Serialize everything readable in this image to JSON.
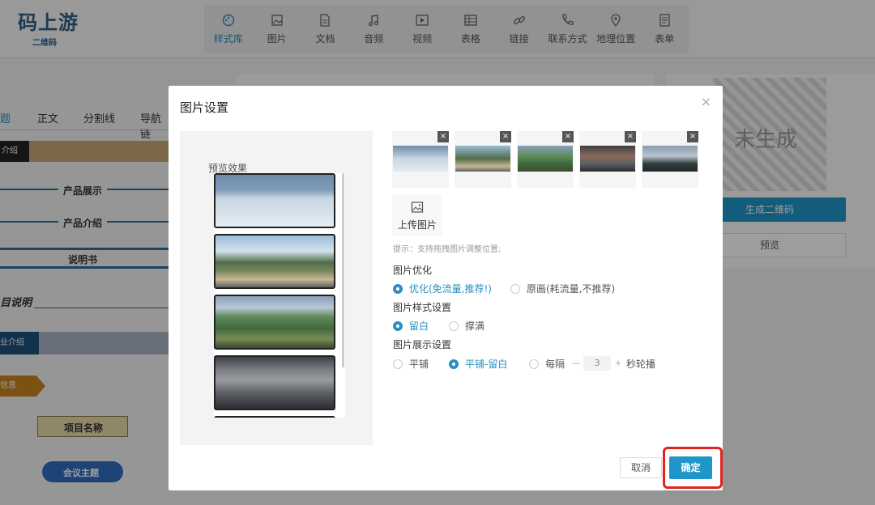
{
  "app": {
    "logo_text": "码上游",
    "logo_sub": "二维码"
  },
  "toolbar": {
    "items": [
      {
        "label": "样式库",
        "icon": "palette-icon"
      },
      {
        "label": "图片",
        "icon": "image-icon"
      },
      {
        "label": "文档",
        "icon": "document-icon"
      },
      {
        "label": "音频",
        "icon": "music-icon"
      },
      {
        "label": "视频",
        "icon": "video-icon"
      },
      {
        "label": "表格",
        "icon": "table-icon"
      },
      {
        "label": "链接",
        "icon": "link-icon"
      },
      {
        "label": "联系方式",
        "icon": "phone-icon"
      },
      {
        "label": "地理位置",
        "icon": "location-icon"
      },
      {
        "label": "表单",
        "icon": "form-icon"
      }
    ],
    "active_color": "#2a8fc0"
  },
  "left_panel": {
    "tabs": [
      "题",
      "正文",
      "分割线",
      "导航链"
    ],
    "items": [
      "介绍",
      "产品展示",
      "产品介绍",
      "说明书",
      "目说明",
      "业介绍",
      "信息",
      "项目名称",
      "会议主题"
    ]
  },
  "right_panel": {
    "qr_status": "未生成",
    "generate_btn": "生成二维码",
    "preview_btn": "预览"
  },
  "modal": {
    "title": "图片设置",
    "close": "×",
    "preview_label": "预览效果",
    "upload_label": "上传图片",
    "hint": "提示：支持拖拽图片调整位置;",
    "optimize": {
      "label": "图片优化",
      "options": [
        {
          "label": "优化(免流量,推荐!)",
          "selected": true
        },
        {
          "label": "原画(耗流量,不推荐)",
          "selected": false
        }
      ]
    },
    "style": {
      "label": "图片样式设置",
      "options": [
        {
          "label": "留白",
          "selected": true
        },
        {
          "label": "撑满",
          "selected": false
        }
      ]
    },
    "display": {
      "label": "图片展示设置",
      "options": [
        {
          "label": "平铺",
          "selected": false
        },
        {
          "label": "平铺-留白",
          "selected": true
        },
        {
          "label": "每隔",
          "selected": false
        }
      ],
      "interval_value": "3",
      "interval_suffix": "秒轮播",
      "minus": "—",
      "plus": "+"
    },
    "cancel_label": "取消",
    "ok_label": "确定",
    "thumb_delete": "×",
    "accent_color": "#1f95c9",
    "highlight_color": "#e0241c"
  }
}
